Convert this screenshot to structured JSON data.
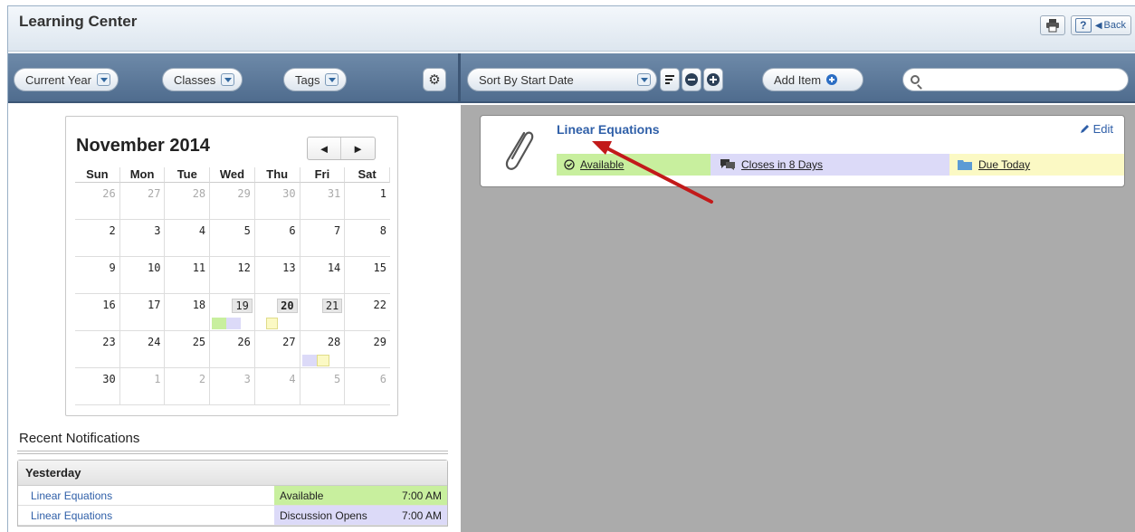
{
  "app": {
    "title": "Learning Center",
    "back_label": "Back",
    "help_label": "?"
  },
  "toolbar": {
    "filters": [
      {
        "label": "Current Year"
      },
      {
        "label": "Classes"
      },
      {
        "label": "Tags"
      }
    ],
    "sort_label": "Sort By Start Date",
    "add_item_label": "Add Item",
    "search_placeholder": ""
  },
  "calendar": {
    "month_label": "November 2014",
    "prev_label": "◄",
    "next_label": "►",
    "days_of_week": [
      "Sun",
      "Mon",
      "Tue",
      "Wed",
      "Thu",
      "Fri",
      "Sat"
    ],
    "weeks": [
      [
        "26",
        "27",
        "28",
        "29",
        "30",
        "31",
        "1"
      ],
      [
        "2",
        "3",
        "4",
        "5",
        "6",
        "7",
        "8"
      ],
      [
        "9",
        "10",
        "11",
        "12",
        "13",
        "14",
        "15"
      ],
      [
        "16",
        "17",
        "18",
        "19",
        "20",
        "21",
        "22"
      ],
      [
        "23",
        "24",
        "25",
        "26",
        "27",
        "28",
        "29"
      ],
      [
        "30",
        "1",
        "2",
        "3",
        "4",
        "5",
        "6"
      ]
    ]
  },
  "notifications": {
    "heading": "Recent Notifications",
    "group_label": "Yesterday",
    "rows": [
      {
        "item": "Linear Equations",
        "status": "Available",
        "time": "7:00 AM",
        "color": "#c8ef9e"
      },
      {
        "item": "Linear Equations",
        "status": "Discussion Opens",
        "time": "7:00 AM",
        "color": "#dcdaf8"
      }
    ]
  },
  "item": {
    "title": "Linear Equations",
    "edit_label": "Edit",
    "statuses": {
      "available": "Available",
      "closes": "Closes in 8 Days",
      "due": "Due Today"
    }
  },
  "colors": {
    "available": "#c8ef9e",
    "discussion": "#dcdaf8",
    "due": "#fbf9c4",
    "annotation_arrow": "#c21a1a"
  }
}
